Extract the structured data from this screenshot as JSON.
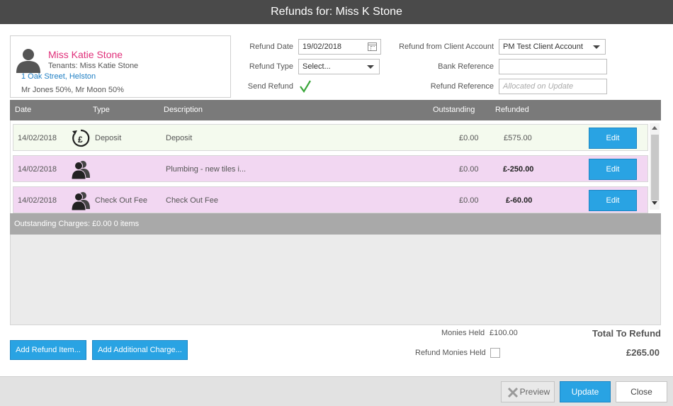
{
  "title": "Refunds for: Miss K Stone",
  "tenant": {
    "name": "Miss Katie Stone",
    "tenants_line": "Tenants: Miss Katie Stone",
    "address": "1 Oak Street, Helston",
    "split": "Mr Jones 50%, Mr Moon 50%"
  },
  "form": {
    "refund_date_label": "Refund Date",
    "refund_date_value": "19/02/2018",
    "refund_type_label": "Refund Type",
    "refund_type_value": "Select...",
    "send_refund_label": "Send Refund",
    "send_refund_checked": true,
    "client_account_label": "Refund from Client Account",
    "client_account_value": "PM Test Client Account",
    "bank_reference_label": "Bank Reference",
    "bank_reference_value": "",
    "refund_reference_label": "Refund Reference",
    "refund_reference_placeholder": "Allocated on Update"
  },
  "grid": {
    "columns": [
      "Date",
      "Type",
      "Description",
      "Outstanding",
      "Refunded"
    ],
    "rows": [
      {
        "date": "14/02/2018",
        "type_icon": "deposit-pound-icon",
        "type": "Deposit",
        "description": "Deposit",
        "outstanding": "£0.00",
        "refunded": "£575.00",
        "edit": "Edit"
      },
      {
        "date": "14/02/2018",
        "type_icon": "tenants-icon",
        "type": "",
        "description": "Plumbing - new tiles i...",
        "outstanding": "£0.00",
        "refunded": "£-250.00",
        "edit": "Edit"
      },
      {
        "date": "14/02/2018",
        "type_icon": "tenants-icon",
        "type": "Check Out Fee",
        "description": "Check Out Fee",
        "outstanding": "£0.00",
        "refunded": "£-60.00",
        "edit": "Edit"
      }
    ]
  },
  "outstanding_charges": "Outstanding Charges: £0.00 0 items",
  "buttons": {
    "add_refund_item": "Add Refund Item...",
    "add_additional_charge": "Add Additional Charge..."
  },
  "summary": {
    "monies_held_label": "Monies Held",
    "monies_held_value": "£100.00",
    "refund_monies_held_label": "Refund Monies Held",
    "total_label": "Total To Refund",
    "total_value": "£265.00"
  },
  "footer": {
    "preview": "Preview",
    "update": "Update",
    "close": "Close"
  },
  "colors": {
    "accent": "#29a3e3",
    "title_bg": "#4a4a4a",
    "name_pink": "#e0307a",
    "row_green": "#f4faee",
    "row_pink": "#f2d7f2"
  }
}
